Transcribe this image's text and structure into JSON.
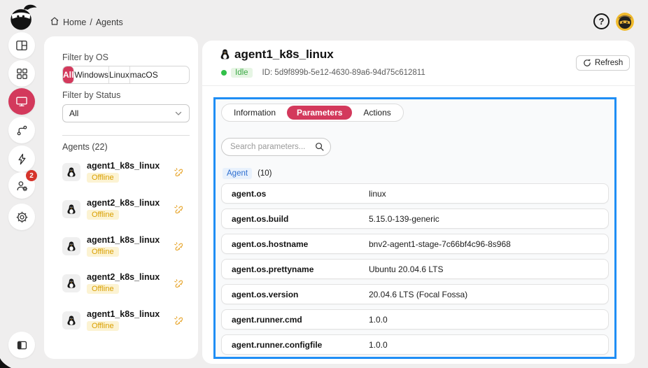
{
  "colors": {
    "accent": "#d3395c",
    "highlight_border": "#1f8ef5",
    "idle_green": "#3ca945",
    "idle_dot": "#31c048",
    "offline_yellow": "#d99f00",
    "badge_red": "#d5342b",
    "agent_chip_blue": "#2e6fd0"
  },
  "rail": {
    "notification_badge": "2"
  },
  "breadcrumb": {
    "home": "Home",
    "separator": "/",
    "current": "Agents"
  },
  "topbar": {
    "help_label": "?"
  },
  "filters": {
    "os_label": "Filter by OS",
    "os_options": [
      {
        "label": "All",
        "active": true
      },
      {
        "label": "Windows",
        "active": false
      },
      {
        "label": "Linux",
        "active": false
      },
      {
        "label": "macOS",
        "active": false
      }
    ],
    "status_label": "Filter by Status",
    "status_value": "All",
    "agents_heading": "Agents (22)",
    "agents": [
      {
        "name": "agent1_k8s_linux",
        "status": "Offline"
      },
      {
        "name": "agent2_k8s_linux",
        "status": "Offline"
      },
      {
        "name": "agent1_k8s_linux",
        "status": "Offline"
      },
      {
        "name": "agent2_k8s_linux",
        "status": "Offline"
      },
      {
        "name": "agent1_k8s_linux",
        "status": "Offline"
      }
    ]
  },
  "detail": {
    "title": "agent1_k8s_linux",
    "status": "Idle",
    "id_text": "ID: 5d9f899b-5e12-4630-89a6-94d75c612811",
    "refresh_label": "Refresh",
    "tabs": [
      {
        "label": "Information",
        "active": false
      },
      {
        "label": "Parameters",
        "active": true
      },
      {
        "label": "Actions",
        "active": false
      }
    ],
    "search_placeholder": "Search parameters...",
    "group_label": "Agent",
    "group_count": "(10)",
    "parameters": [
      {
        "key": "agent.os",
        "value": "linux"
      },
      {
        "key": "agent.os.build",
        "value": "5.15.0-139-generic"
      },
      {
        "key": "agent.os.hostname",
        "value": "bnv2-agent1-stage-7c66bf4c96-8s968"
      },
      {
        "key": "agent.os.prettyname",
        "value": "Ubuntu 20.04.6 LTS"
      },
      {
        "key": "agent.os.version",
        "value": "20.04.6 LTS (Focal Fossa)"
      },
      {
        "key": "agent.runner.cmd",
        "value": "1.0.0"
      },
      {
        "key": "agent.runner.configfile",
        "value": "1.0.0"
      }
    ]
  }
}
